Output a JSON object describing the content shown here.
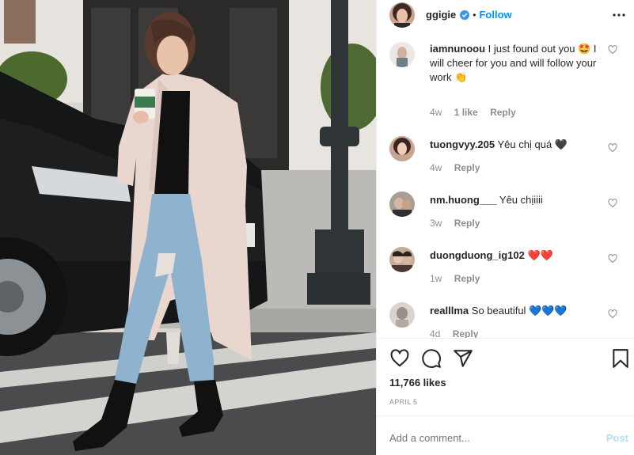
{
  "post": {
    "username": "ggigie",
    "follow_label": "Follow",
    "separator": "•",
    "likes_text": "11,766 likes",
    "date": "APRIL 5"
  },
  "comments": [
    {
      "user": "iamnunoou",
      "text": "I just found out you 🤩 I will cheer for you and will follow your work 👏",
      "age": "4w",
      "likes": "1 like",
      "reply": "Reply"
    },
    {
      "user": "tuongvyy.205",
      "text": "Yêu chị quá 🖤",
      "age": "4w",
      "likes": "",
      "reply": "Reply"
    },
    {
      "user": "nm.huong___",
      "text": "Yêu chịiiii",
      "age": "3w",
      "likes": "",
      "reply": "Reply"
    },
    {
      "user": "duongduong_ig102",
      "text": "❤️❤️",
      "age": "1w",
      "likes": "",
      "reply": "Reply"
    },
    {
      "user": "realllma",
      "text": "So beautiful 💙💙💙",
      "age": "4d",
      "likes": "",
      "reply": "Reply"
    }
  ],
  "add_comment": {
    "placeholder": "Add a comment...",
    "post_label": "Post"
  },
  "icons": {
    "verified": "verified-badge-icon",
    "more": "more-options-icon",
    "like": "heart-icon",
    "comment": "comment-icon",
    "share": "share-icon",
    "save": "bookmark-icon"
  },
  "colors": {
    "follow": "#0095f6",
    "post_disabled": "#b2dffc",
    "meta": "#8e8e8e",
    "text": "#262626"
  }
}
